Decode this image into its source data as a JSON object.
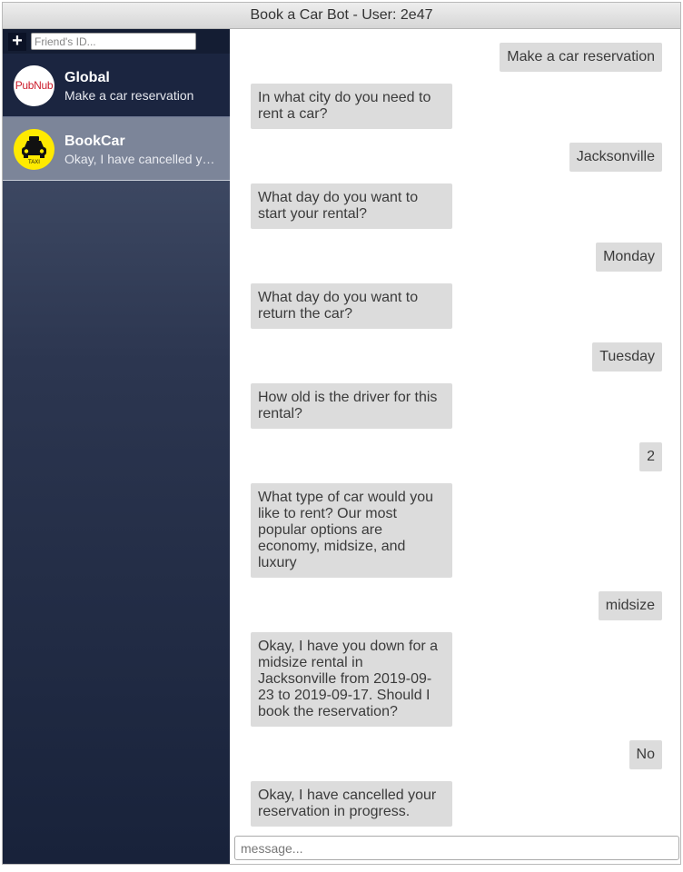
{
  "window": {
    "title": "Book a Car Bot - User: 2e47"
  },
  "sidebar": {
    "add_button": "+",
    "friend_input": {
      "placeholder": "Friend's ID...",
      "value": ""
    },
    "conversations": [
      {
        "name": "Global",
        "preview": "Make a car reservation",
        "avatar": "pubnub-logo",
        "avatar_text": "PubNub"
      },
      {
        "name": "BookCar",
        "preview": "Okay, I have cancelled your reservation in progress.",
        "avatar": "taxi-icon",
        "avatar_text": "TAXI"
      }
    ]
  },
  "chat": {
    "messages": [
      {
        "from": "user",
        "text": "Make a car reservation"
      },
      {
        "from": "bot",
        "text": "In what city do you need to rent a car?"
      },
      {
        "from": "user",
        "text": "Jacksonville"
      },
      {
        "from": "bot",
        "text": "What day do you want to start your rental?"
      },
      {
        "from": "user",
        "text": "Monday"
      },
      {
        "from": "bot",
        "text": "What day do you want to return the car?"
      },
      {
        "from": "user",
        "text": "Tuesday"
      },
      {
        "from": "bot",
        "text": "How old is the driver for this rental?"
      },
      {
        "from": "user",
        "text": "2"
      },
      {
        "from": "bot",
        "text": "What type of car would you like to rent? Our most popular options are economy, midsize, and luxury"
      },
      {
        "from": "user",
        "text": "midsize"
      },
      {
        "from": "bot",
        "text": "Okay, I have you down for a midsize rental in Jacksonville from 2019-09-23 to 2019-09-17. Should I book the reservation?"
      },
      {
        "from": "user",
        "text": "No"
      },
      {
        "from": "bot",
        "text": "Okay, I have cancelled your reservation in progress."
      }
    ],
    "message_input": {
      "placeholder": "message...",
      "value": ""
    }
  },
  "colors": {
    "bubble": "#dcdcdc",
    "sidebar_dark": "#18223a",
    "selected_conv": "#7c8599",
    "pubnub_red": "#cc1e2d",
    "taxi_yellow": "#ffea00"
  }
}
